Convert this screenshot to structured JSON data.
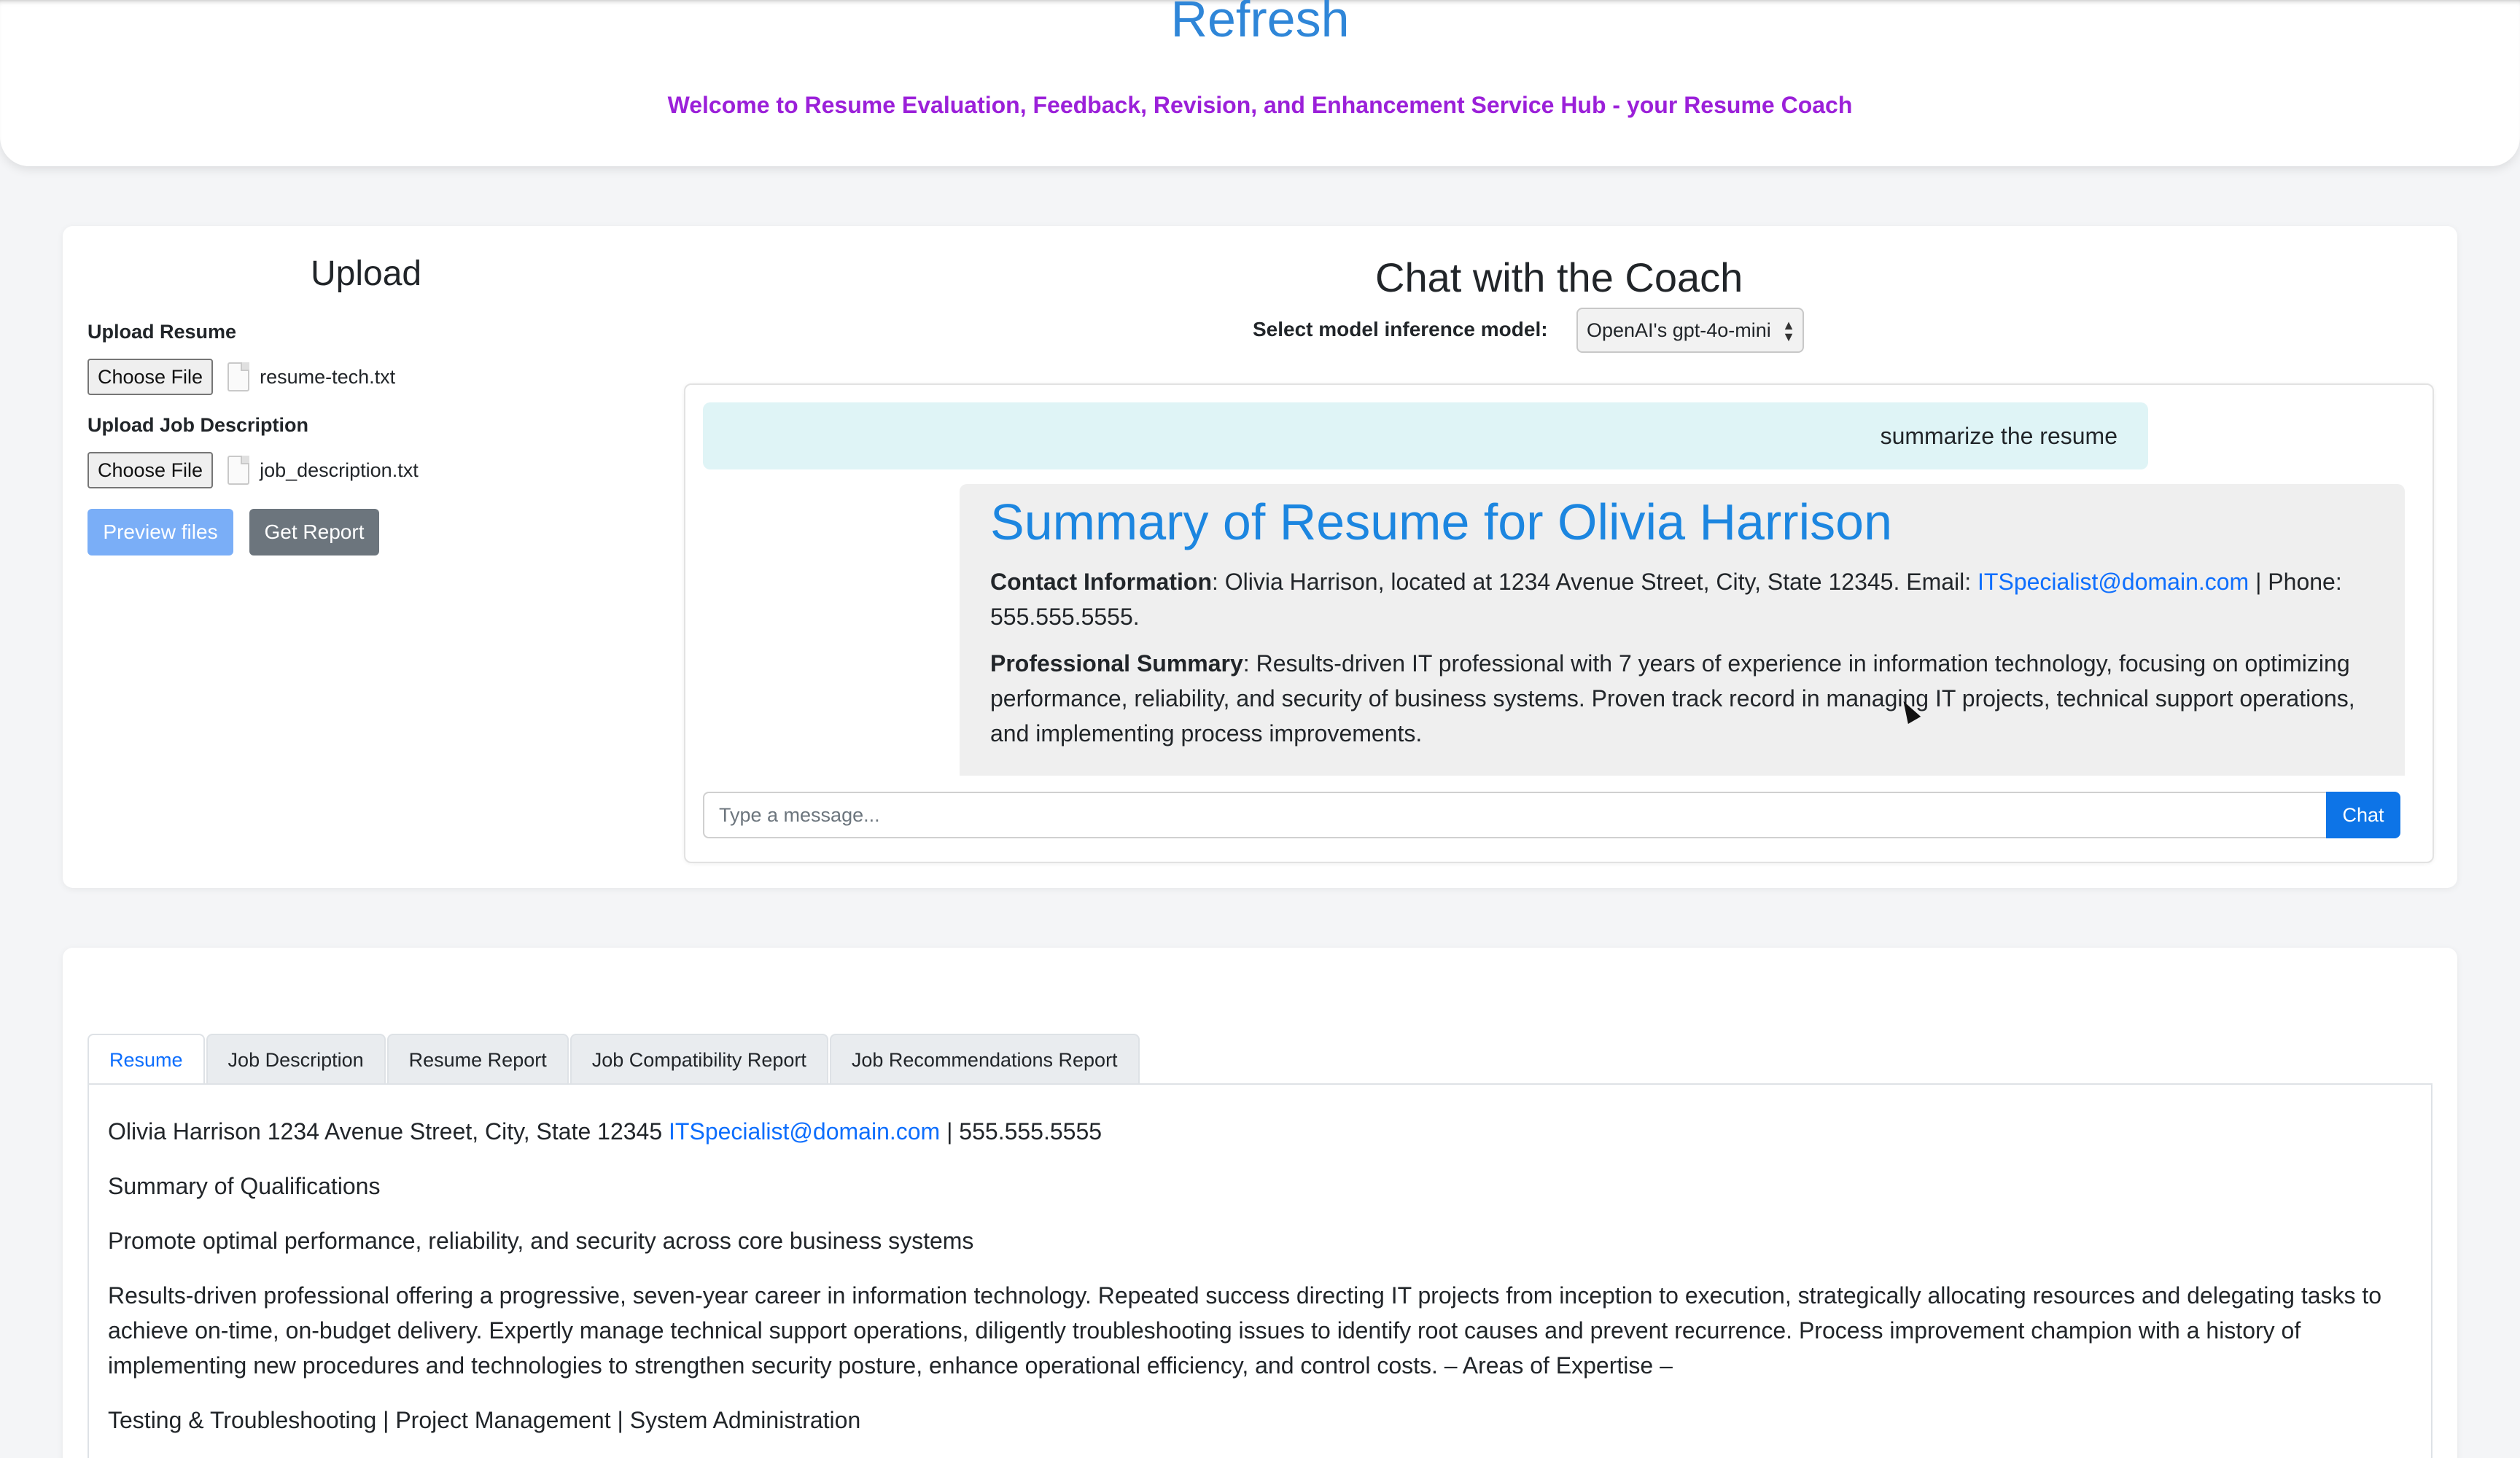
{
  "header": {
    "title": "Refresh",
    "welcome": "Welcome to Resume Evaluation, Feedback, Revision, and Enhancement Service Hub - your Resume Coach"
  },
  "upload": {
    "title": "Upload",
    "resume_label": "Upload Resume",
    "resume_button": "Choose File",
    "resume_file": "resume-tech.txt",
    "job_label": "Upload Job Description",
    "job_button": "Choose File",
    "job_file": "job_description.txt",
    "preview_button": "Preview files",
    "report_button": "Get Report"
  },
  "chat": {
    "title": "Chat with the Coach",
    "model_label": "Select model inference model:",
    "model_selected": "OpenAI's gpt-4o-mini",
    "user_message": "summarize the resume",
    "bot": {
      "heading": "Summary of Resume for Olivia Harrison",
      "contact_label": "Contact Information",
      "contact_text_1": ": Olivia Harrison, located at 1234 Avenue Street, City, State 12345. Email: ",
      "contact_email": "ITSpecialist@domain.com",
      "contact_text_2": " | Phone: 555.555.5555.",
      "summary_label": "Professional Summary",
      "summary_text": ": Results-driven IT professional with 7 years of experience in information technology, focusing on optimizing performance, reliability, and security of business systems. Proven track record in managing IT projects, technical support operations, and implementing process improvements."
    },
    "input_placeholder": "Type a message...",
    "send_button": "Chat"
  },
  "tabs": {
    "items": [
      {
        "label": "Resume",
        "active": true
      },
      {
        "label": "Job Description",
        "active": false
      },
      {
        "label": "Resume Report",
        "active": false
      },
      {
        "label": "Job Compatibility Report",
        "active": false
      },
      {
        "label": "Job Recommendations Report",
        "active": false
      }
    ]
  },
  "resume": {
    "line1_a": "Olivia Harrison 1234 Avenue Street, City, State 12345 ",
    "line1_email": "ITSpecialist@domain.com",
    "line1_b": " | 555.555.5555",
    "line2": "Summary of Qualifications",
    "line3": "Promote optimal performance, reliability, and security across core business systems",
    "line4": "Results-driven professional offering a progressive, seven-year career in information technology. Repeated success directing IT projects from inception to execution, strategically allocating resources and delegating tasks to achieve on-time, on-budget delivery. Expertly manage technical support operations, diligently troubleshooting issues to identify root causes and prevent recurrence. Process improvement champion with a history of implementing new procedures and technologies to strengthen security posture, enhance operational efficiency, and control costs. – Areas of Expertise –",
    "line5": "Testing & Troubleshooting | Project Management | System Administration"
  },
  "colors": {
    "accent": "#2f86d8",
    "welcome": "#9b20d9",
    "primary_button": "#0d74e7",
    "user_bubble": "#dff4f6",
    "bot_bubble": "#efefef"
  }
}
